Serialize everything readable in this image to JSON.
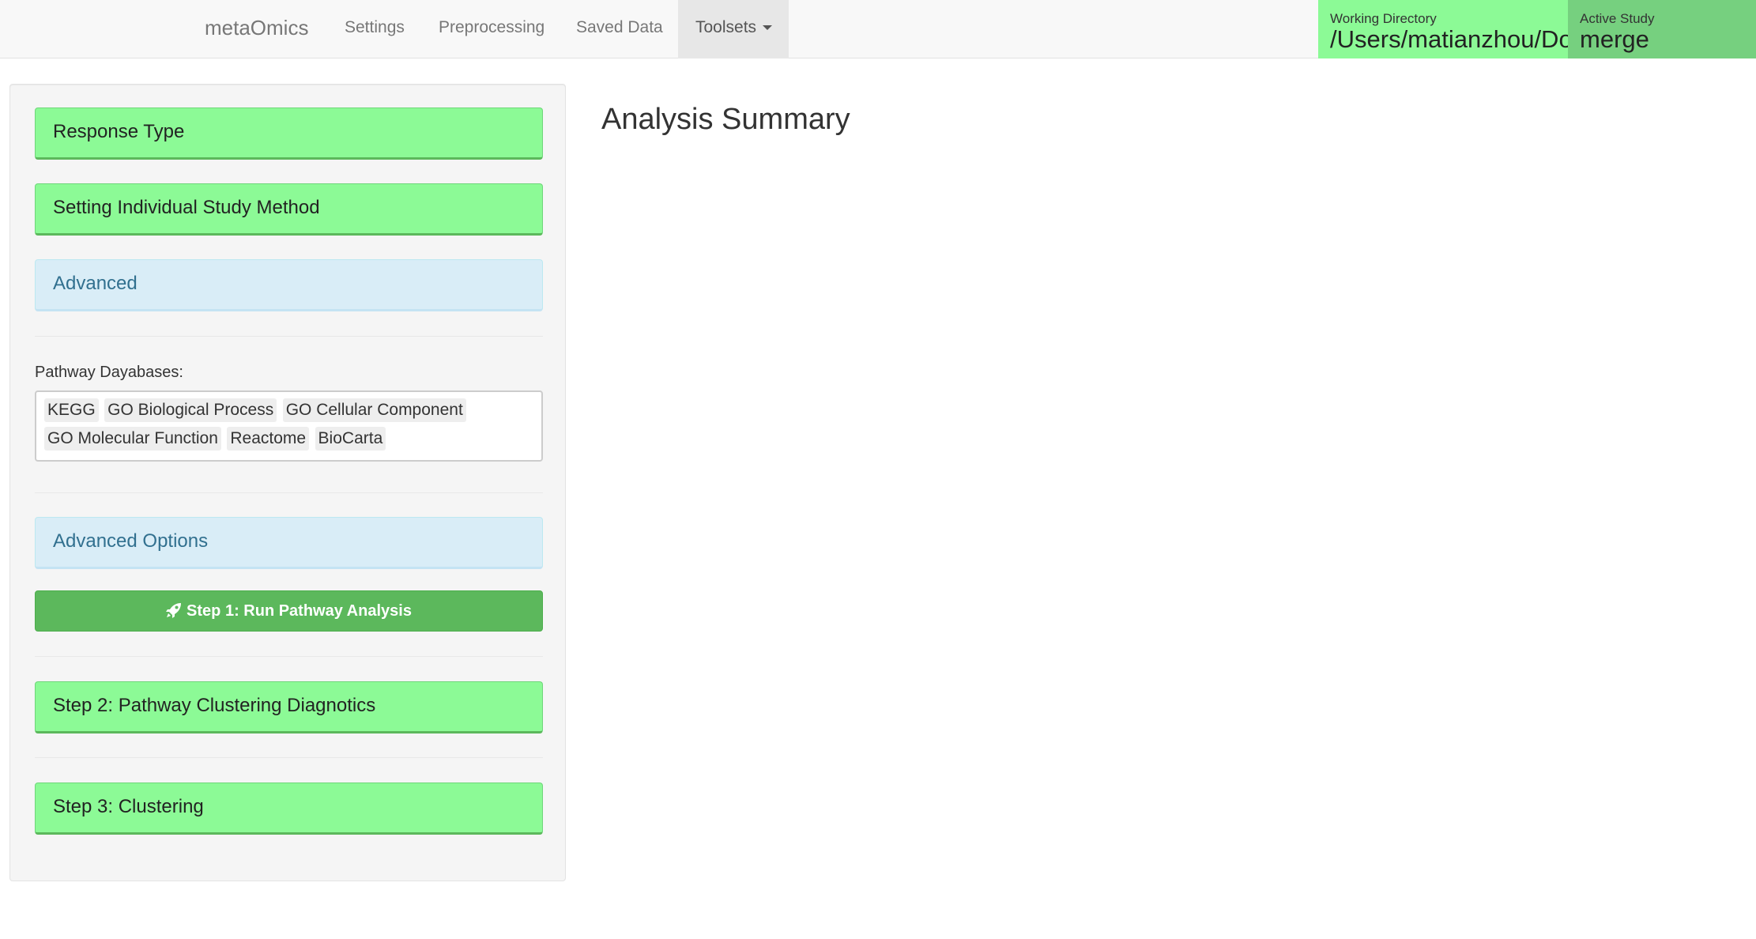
{
  "navbar": {
    "brand": "metaOmics",
    "items": [
      "Settings",
      "Preprocessing",
      "Saved Data"
    ],
    "toolsets_label": "Toolsets"
  },
  "status": {
    "working_directory_label": "Working Directory",
    "working_directory_value": "/Users/matianzhou/Documents",
    "active_study_label": "Active Study",
    "active_study_value": "merge"
  },
  "sidebar": {
    "response_type": "Response Type",
    "individual_method": "Setting Individual Study Method",
    "advanced": "Advanced",
    "pathway_label": "Pathway Dayabases:",
    "pathway_tags": [
      "KEGG",
      "GO Biological Process",
      "GO Cellular Component",
      "GO Molecular Function",
      "Reactome",
      "BioCarta"
    ],
    "advanced_options": "Advanced Options",
    "step1_button": "Step 1: Run Pathway Analysis",
    "step2": "Step 2: Pathway Clustering Diagnotics",
    "step3": "Step 3: Clustering"
  },
  "main": {
    "title": "Analysis Summary"
  },
  "colors": {
    "accent_green": "#8cfa96",
    "active_study_green": "#76d07f",
    "button_green": "#5cb85c",
    "info_blue": "#d9edf7"
  },
  "icons": {
    "run_icon": "rocket-icon",
    "toolsets_caret": "caret-down-icon"
  }
}
